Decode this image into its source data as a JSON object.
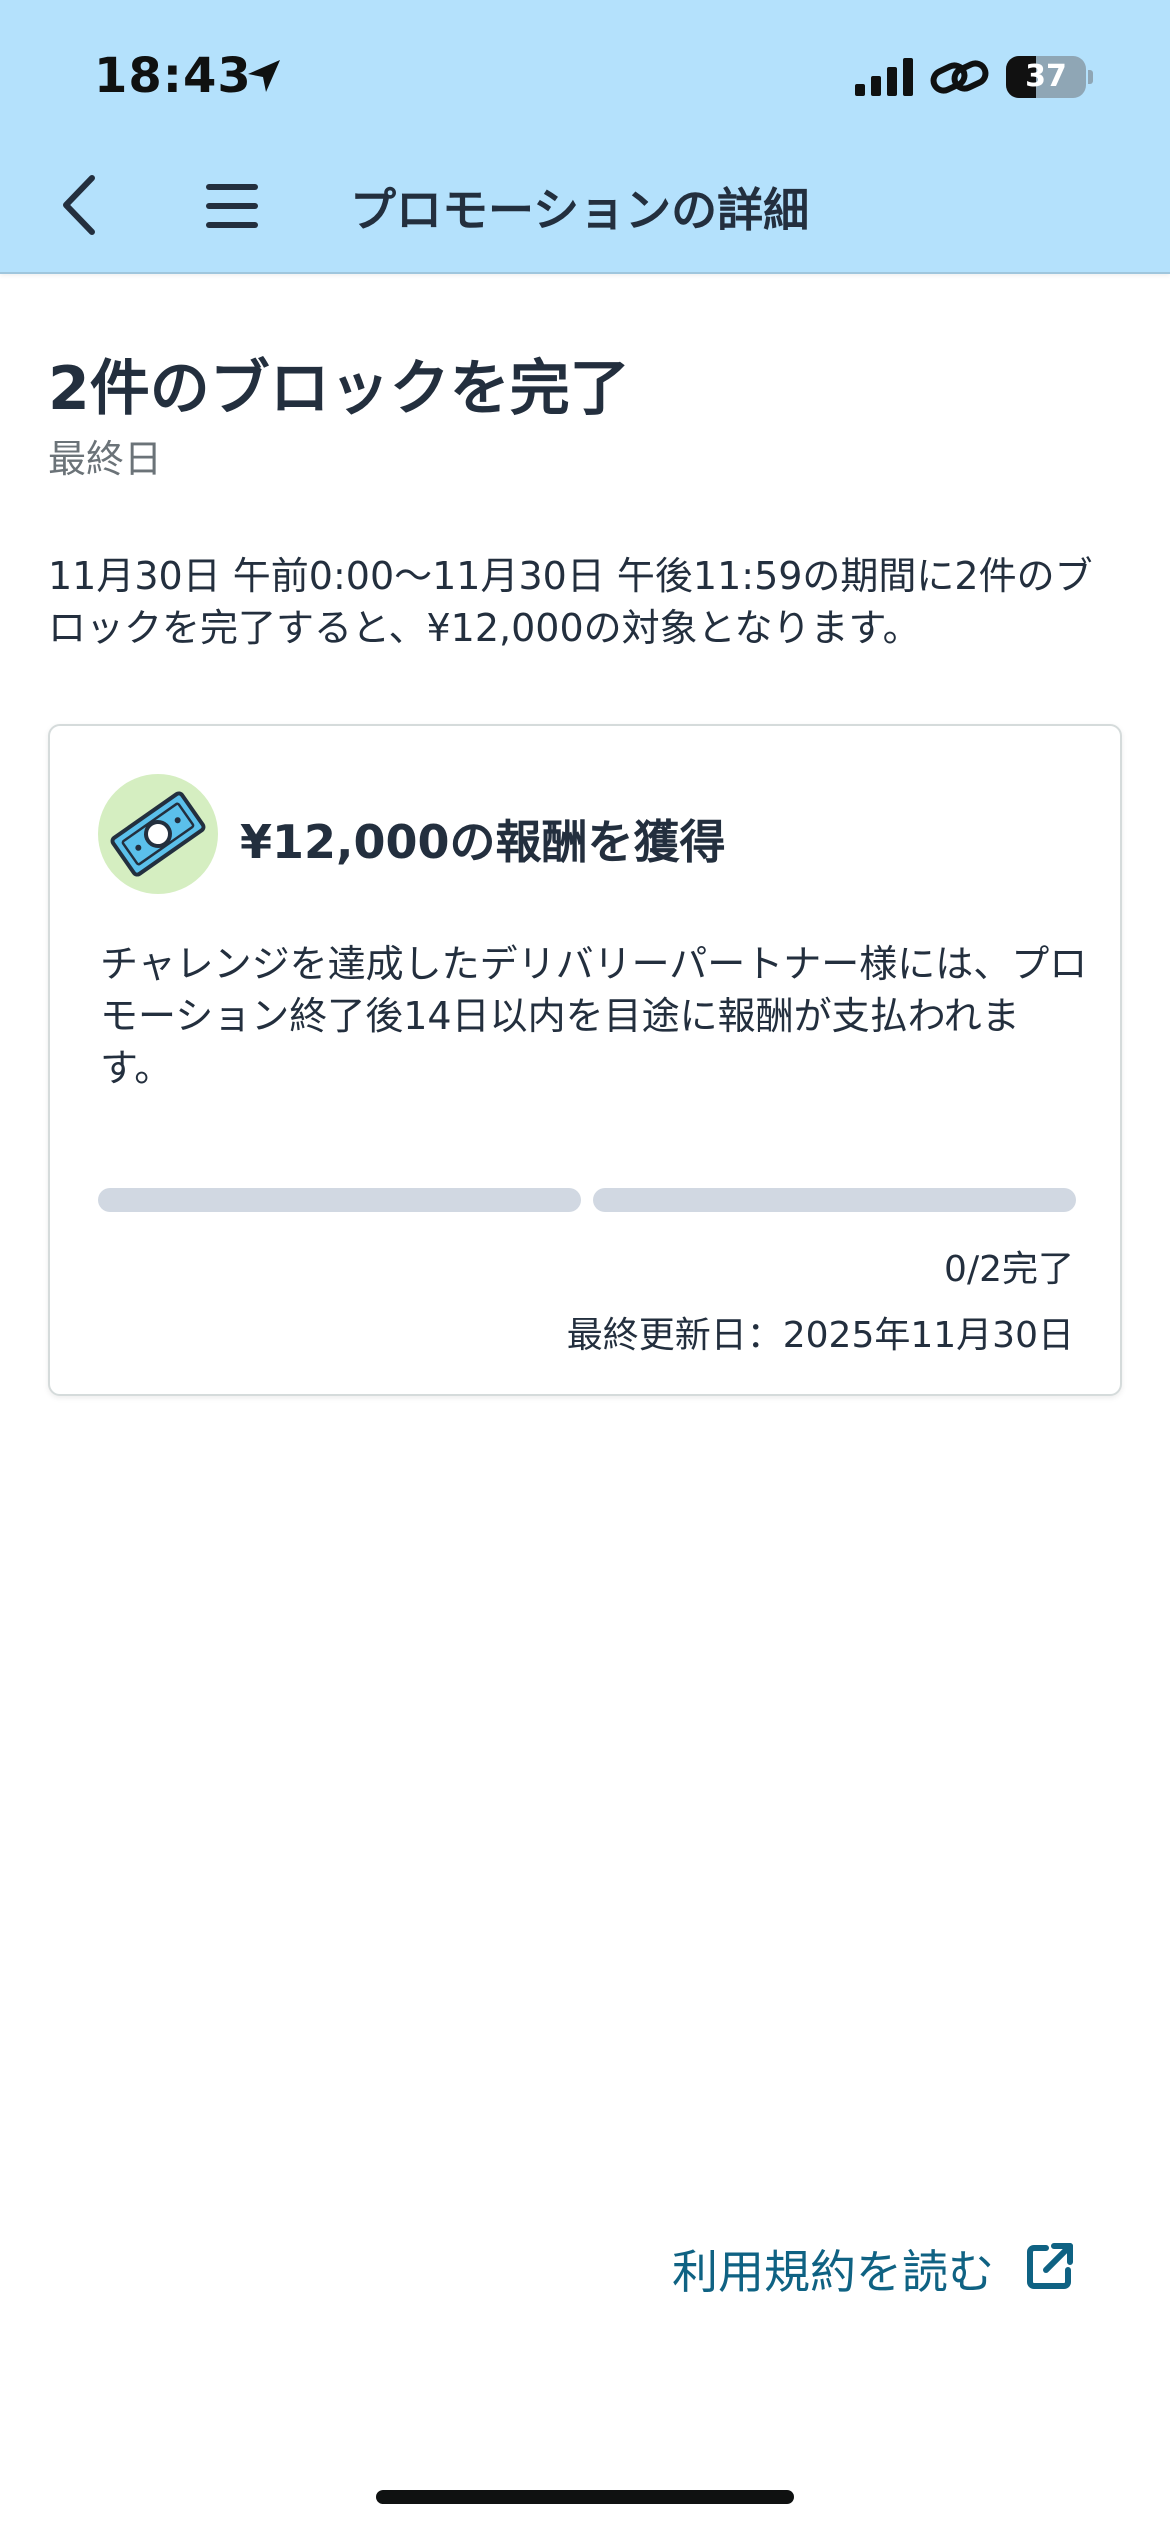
{
  "status_bar": {
    "time": "18:43",
    "battery_level": "37",
    "battery_fraction": 0.37,
    "icons": [
      "location-arrow-icon",
      "cellular-signal-icon",
      "link-icon",
      "battery-icon"
    ]
  },
  "header": {
    "title": "プロモーションの詳細",
    "icons": [
      "back-chevron-icon",
      "hamburger-menu-icon"
    ]
  },
  "promotion": {
    "title": "2件のブロックを完了",
    "subtitle": "最終日",
    "description": "11月30日 午前0:00〜11月30日 午後11:59の期間に2件のブロックを完了すると、¥12,000の対象となります。"
  },
  "reward_card": {
    "icon": "money-bill-icon",
    "title": "¥12,000の報酬を獲得",
    "description": "チャレンジを達成したデリバリーパートナー様には、プロモーション終了後14日以内を目途に報酬が支払われます。",
    "progress": {
      "completed": 0,
      "total": 2
    },
    "progress_label": "0/2完了",
    "last_updated": "最終更新日：2025年11月30日"
  },
  "footer": {
    "terms_link": "利用規約を読む",
    "icon": "external-link-icon"
  },
  "colors": {
    "header_bg": "#b4e1fc",
    "text_primary": "#232f3e",
    "text_secondary": "#6b7378",
    "link": "#0f6283",
    "progress_track": "#d1d8e2",
    "badge_bg": "#d5eec1"
  }
}
